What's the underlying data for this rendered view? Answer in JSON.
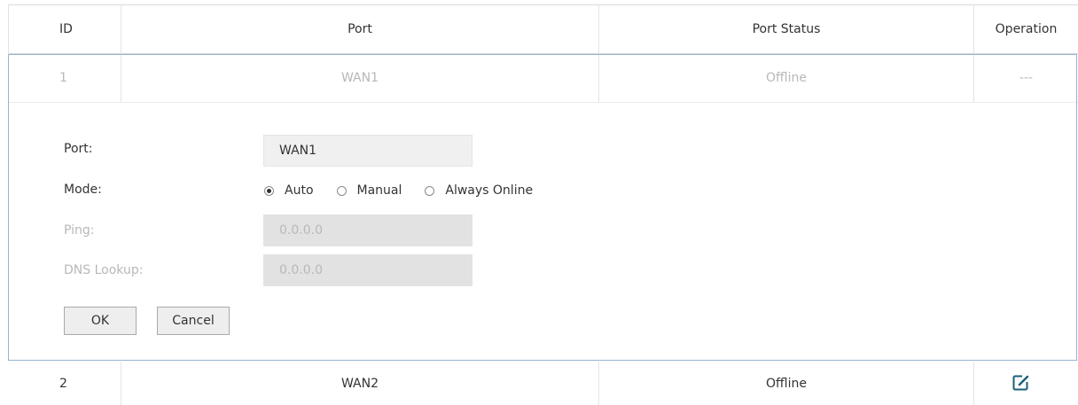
{
  "table": {
    "headers": {
      "id": "ID",
      "port": "Port",
      "port_status": "Port Status",
      "operation": "Operation"
    },
    "rows": [
      {
        "id": "1",
        "port": "WAN1",
        "status": "Offline",
        "operation": "---"
      },
      {
        "id": "2",
        "port": "WAN2",
        "status": "Offline",
        "operation_icon": "edit-icon"
      }
    ]
  },
  "edit_form": {
    "port_label": "Port:",
    "port_value": "WAN1",
    "mode_label": "Mode:",
    "mode_options": [
      "Auto",
      "Manual",
      "Always Online"
    ],
    "mode_selected": "Auto",
    "ping_label": "Ping:",
    "ping_value": "0.0.0.0",
    "dns_label": "DNS Lookup:",
    "dns_value": "0.0.0.0",
    "ok_label": "OK",
    "cancel_label": "Cancel"
  },
  "colors": {
    "panel_border": "#96b4cf",
    "edit_icon": "#1a5f7a",
    "disabled_text": "#b8b8b8"
  }
}
